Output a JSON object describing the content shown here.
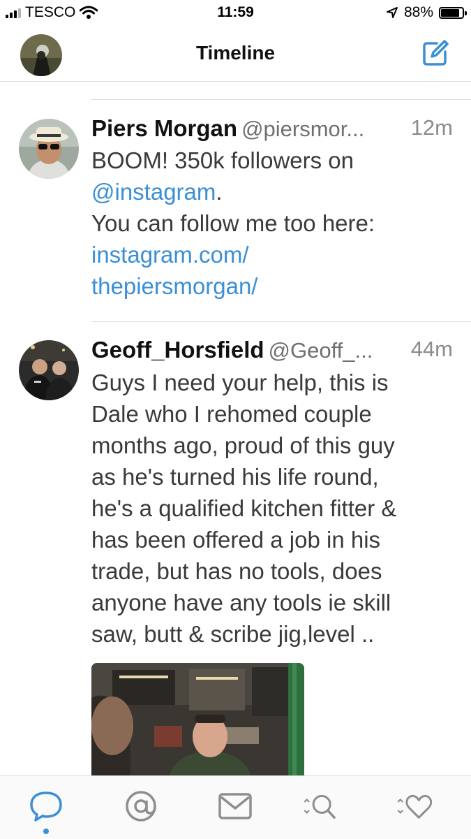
{
  "status_bar": {
    "carrier": "TESCO",
    "time": "11:59",
    "battery": "88%",
    "battery_level": 0.88
  },
  "nav": {
    "title": "Timeline",
    "compose_icon": "compose-icon"
  },
  "tweets": [
    {
      "name": "Piers Morgan",
      "handle": "@piersmor...",
      "time": "12m",
      "line1": "BOOM! 350k followers on",
      "mention": "@instagram",
      "line2_rest": ".",
      "line3": "You can follow me too here:",
      "link1": "instagram.com/",
      "link2": "thepiersmorgan/"
    },
    {
      "name": "Geoff_Horsfield",
      "handle": "@Geoff_...",
      "time": "44m",
      "lines": [
        "Guys I need your help, this is",
        "Dale who I rehomed couple",
        "months ago, proud of this guy",
        "as he's turned his life round,",
        "he's a qualified kitchen fitter &",
        "has been offered a job in his",
        "trade, but has no tools, does",
        "anyone have any tools ie skill",
        "saw, butt & scribe jig,level .."
      ]
    }
  ],
  "tab_bar": {
    "tabs": [
      "timeline-icon",
      "mentions-icon",
      "messages-icon",
      "search-icon",
      "likes-icon"
    ],
    "accent": "#3b8fd6"
  }
}
